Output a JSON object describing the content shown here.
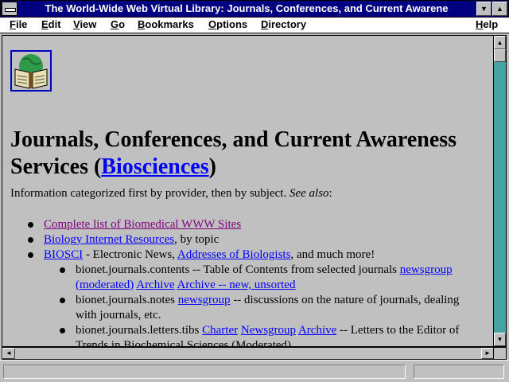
{
  "window": {
    "title": "The World-Wide Web Virtual Library: Journals, Conferences, and Current Awarene"
  },
  "menu": {
    "items": [
      {
        "accel": "F",
        "rest": "ile"
      },
      {
        "accel": "E",
        "rest": "dit"
      },
      {
        "accel": "V",
        "rest": "iew"
      },
      {
        "accel": "G",
        "rest": "o"
      },
      {
        "accel": "B",
        "rest": "ookmarks"
      },
      {
        "accel": "O",
        "rest": "ptions"
      },
      {
        "accel": "D",
        "rest": "irectory"
      },
      {
        "accel": "H",
        "rest": "elp"
      }
    ]
  },
  "page": {
    "heading_prefix": "Journals, Conferences, and Current Awareness Services (",
    "heading_link": "Biosciences",
    "heading_suffix": ")",
    "intro_text": "Information categorized first by provider, then by subject. ",
    "intro_see_also": "See also",
    "intro_colon": ":",
    "items": {
      "biomed": "Complete list of Biomedical WWW Sites",
      "bio_resources": "Biology Internet Resources",
      "bio_resources_suffix": ", by topic",
      "biosci": "BIOSCI",
      "biosci_text": " - Electronic News, ",
      "biosci_addresses": "Addresses of Biologists",
      "biosci_suffix": ", and much more!",
      "sub1_text": "bionet.journals.contents -- Table of Contents from selected journals ",
      "sub1_link1": "newsgroup (moderated)",
      "sub1_link2": "Archive",
      "sub1_link3": "Archive -- new, unsorted",
      "sub2_text": "bionet.journals.notes ",
      "sub2_link": "newsgroup",
      "sub2_suffix": " -- discussions on the nature of journals, dealing with journals, etc.",
      "sub3_text": "bionet.journals.letters.tibs ",
      "sub3_link1": "Charter",
      "sub3_link2": "Newsgroup",
      "sub3_link3": "Archive",
      "sub3_suffix": " -- Letters to the Editor of Trends in Biochemical Sciences (Moderated)"
    }
  },
  "status": {
    "message": ""
  }
}
